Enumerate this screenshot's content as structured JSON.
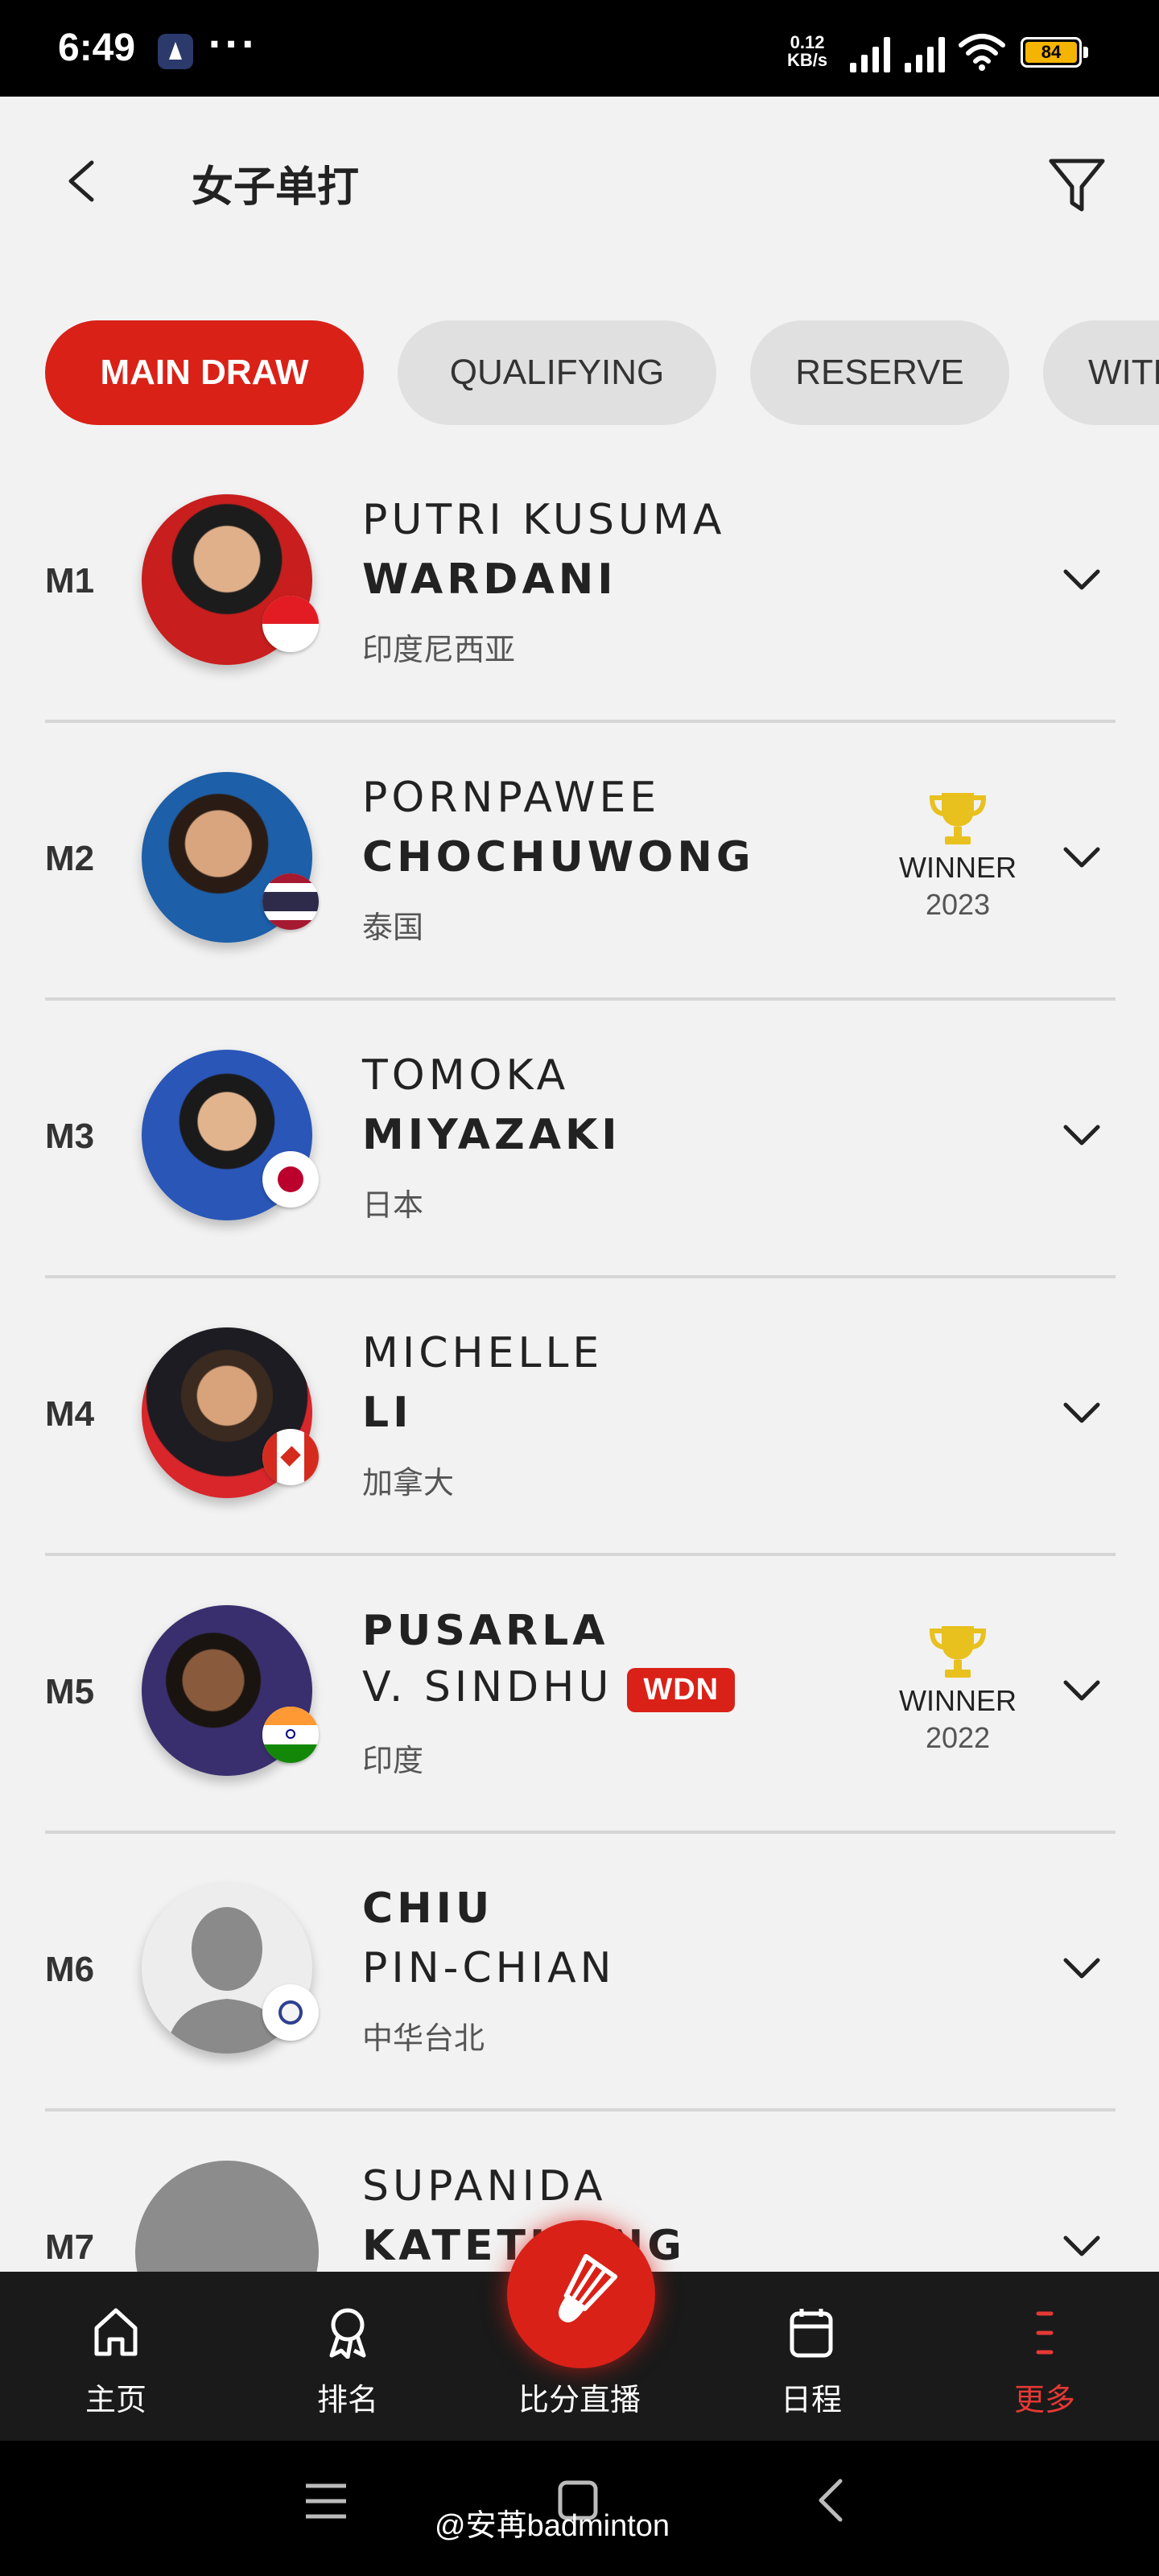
{
  "status_bar": {
    "time": "6:49",
    "dots": "···",
    "net_speed": "0.12",
    "net_unit": "KB/s",
    "battery": "84",
    "colors": {
      "battery": "#f4b400"
    }
  },
  "header": {
    "title": "女子单打",
    "back_icon": "chevron-left-icon",
    "filter_icon": "filter-icon"
  },
  "tabs": [
    {
      "label": "MAIN DRAW",
      "active": true
    },
    {
      "label": "QUALIFYING",
      "active": false
    },
    {
      "label": "RESERVE",
      "active": false
    },
    {
      "label": "WITHDRAWN",
      "active": false
    }
  ],
  "players": [
    {
      "seed": "M1",
      "line1": "PUTRI KUSUMA",
      "line2": "WARDANI",
      "country": "印度尼西亚"
    },
    {
      "seed": "M2",
      "line1": "PORNPAWEE",
      "line2": "CHOCHUWONG",
      "country": "泰国",
      "winner_label": "WINNER",
      "winner_year": "2023"
    },
    {
      "seed": "M3",
      "line1": "TOMOKA",
      "line2": "MIYAZAKI",
      "country": "日本"
    },
    {
      "seed": "M4",
      "line1": "MICHELLE",
      "line2": "LI",
      "country": "加拿大"
    },
    {
      "seed": "M5",
      "line1": "PUSARLA",
      "line2": "V. SINDHU",
      "badge": "WDN",
      "country": "印度",
      "winner_label": "WINNER",
      "winner_year": "2022"
    },
    {
      "seed": "M6",
      "line1": "CHIU",
      "line2": "PIN-CHIAN",
      "country": "中华台北"
    },
    {
      "seed": "M7",
      "line1": "SUPANIDA",
      "line2": "KATETHONG"
    }
  ],
  "bottom_nav": {
    "items": [
      {
        "label": "主页",
        "icon": "home-icon"
      },
      {
        "label": "排名",
        "icon": "award-icon"
      },
      {
        "label": "比分直播",
        "icon": "shuttlecock-icon"
      },
      {
        "label": "日程",
        "icon": "calendar-icon"
      },
      {
        "label": "更多",
        "icon": "more-icon",
        "active": true
      }
    ],
    "colors": {
      "accent": "#d92118",
      "active_label": "#e53935"
    }
  },
  "watermark": "@安苒badminton"
}
